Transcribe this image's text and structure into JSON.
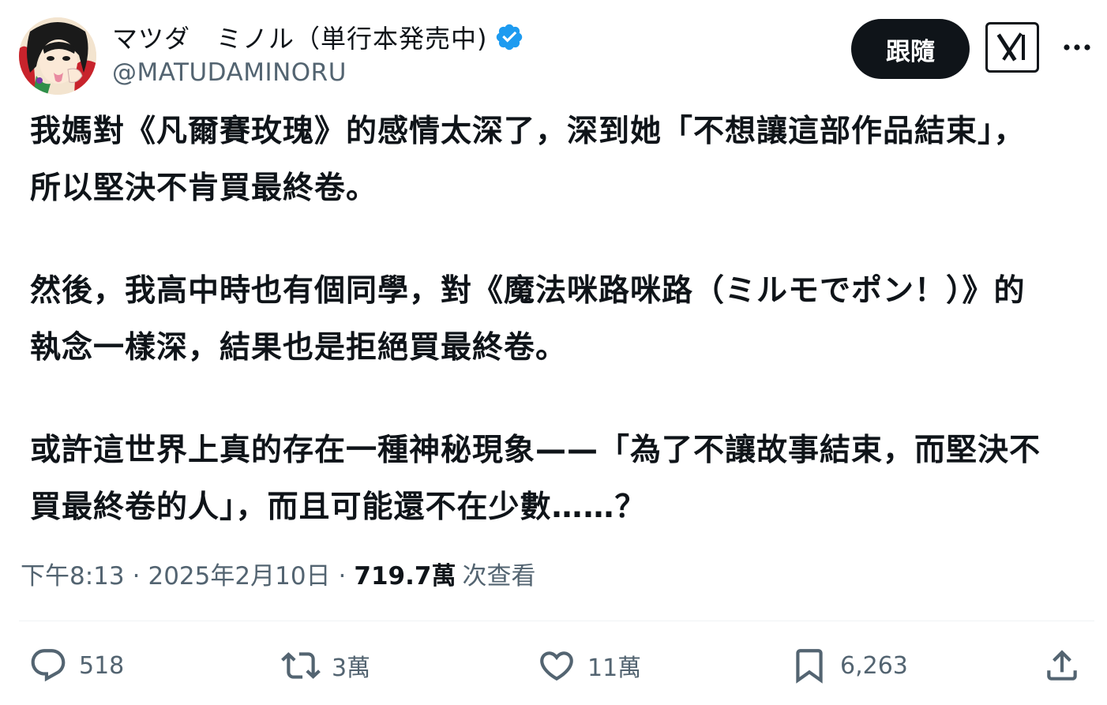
{
  "author": {
    "display_name": "マツダ　ミノル（単行本発売中)",
    "handle": "@MATUDAMINORU",
    "verified": true
  },
  "follow_button_label": "跟隨",
  "tweet": {
    "paragraphs": [
      "我媽對《凡爾賽玫瑰》的感情太深了，深到她「不想讓這部作品結束」，所以堅決不肯買最終卷。",
      "然後，我高中時也有個同學，對《魔法咪路咪路（ミルモでポン！）》的執念一樣深，結果也是拒絕買最終卷。",
      "或許這世界上真的存在一種神秘現象——「為了不讓故事結束，而堅決不買最終卷的人」，而且可能還不在少數……？"
    ]
  },
  "meta": {
    "time": "下午8:13",
    "date": "2025年2月10日",
    "separator": "·",
    "views_count": "719.7萬",
    "views_label": "次查看"
  },
  "actions": {
    "reply_count": "518",
    "repost_count": "3萬",
    "like_count": "11萬",
    "bookmark_count": "6,263"
  },
  "colors": {
    "text_primary": "#0f1419",
    "text_secondary": "#536471",
    "verified_blue": "#1d9bf0",
    "follow_bg": "#0f1419"
  }
}
